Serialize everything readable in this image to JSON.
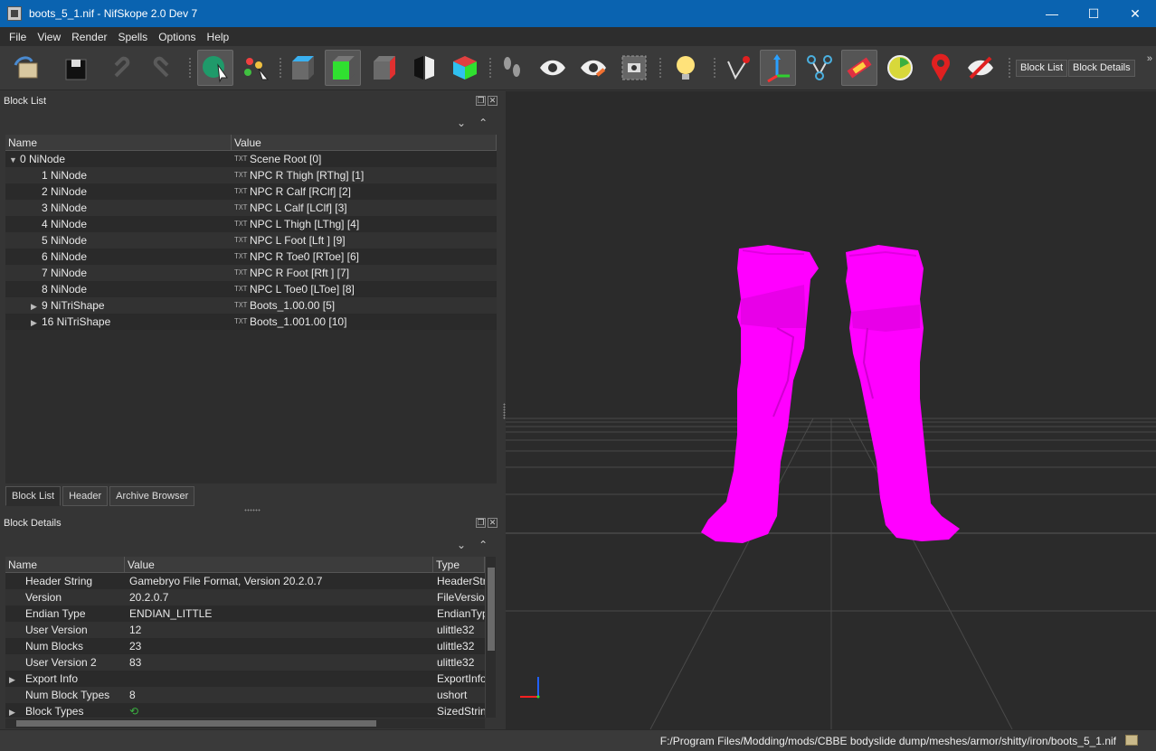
{
  "window": {
    "title": "boots_5_1.nif - NifSkope 2.0 Dev 7",
    "controls": [
      "—",
      "☐",
      "✕"
    ]
  },
  "menu": [
    "File",
    "View",
    "Render",
    "Spells",
    "Options",
    "Help"
  ],
  "toolbar": {
    "block_list_label": "Block List",
    "block_details_label": "Block Details",
    "extension_glyph": "»"
  },
  "block_list": {
    "title": "Block List",
    "columns": [
      "Name",
      "Value"
    ],
    "rows": [
      {
        "arrow": "▼",
        "name": "0 NiNode",
        "value": "Scene Root [0]",
        "level": 0
      },
      {
        "arrow": "",
        "name": "1 NiNode",
        "value": "NPC R Thigh [RThg] [1]",
        "level": 1
      },
      {
        "arrow": "",
        "name": "2 NiNode",
        "value": "NPC R Calf [RClf] [2]",
        "level": 1
      },
      {
        "arrow": "",
        "name": "3 NiNode",
        "value": "NPC L Calf [LClf] [3]",
        "level": 1
      },
      {
        "arrow": "",
        "name": "4 NiNode",
        "value": "NPC L Thigh [LThg] [4]",
        "level": 1
      },
      {
        "arrow": "",
        "name": "5 NiNode",
        "value": "NPC L Foot [Lft ] [9]",
        "level": 1
      },
      {
        "arrow": "",
        "name": "6 NiNode",
        "value": "NPC R Toe0 [RToe] [6]",
        "level": 1
      },
      {
        "arrow": "",
        "name": "7 NiNode",
        "value": "NPC R Foot [Rft ] [7]",
        "level": 1
      },
      {
        "arrow": "",
        "name": "8 NiNode",
        "value": "NPC L Toe0 [LToe] [8]",
        "level": 1
      },
      {
        "arrow": "▶",
        "name": "9 NiTriShape",
        "value": "Boots_1.00.00 [5]",
        "level": 1
      },
      {
        "arrow": "▶",
        "name": "16 NiTriShape",
        "value": "Boots_1.001.00 [10]",
        "level": 1
      }
    ],
    "txt_icon": "TXT",
    "tabs": [
      "Block List",
      "Header",
      "Archive Browser"
    ]
  },
  "block_details": {
    "title": "Block Details",
    "columns": [
      "Name",
      "Value",
      "Type"
    ],
    "rows": [
      {
        "arrow": "",
        "name": "Header String",
        "value": "Gamebryo File Format, Version 20.2.0.7",
        "type": "HeaderStr"
      },
      {
        "arrow": "",
        "name": "Version",
        "value": "20.2.0.7",
        "type": "FileVersion"
      },
      {
        "arrow": "",
        "name": "Endian Type",
        "value": "ENDIAN_LITTLE",
        "type": "EndianTyp"
      },
      {
        "arrow": "",
        "name": "User Version",
        "value": "12",
        "type": "ulittle32"
      },
      {
        "arrow": "",
        "name": "Num Blocks",
        "value": "23",
        "type": "ulittle32"
      },
      {
        "arrow": "",
        "name": "User Version 2",
        "value": "83",
        "type": "ulittle32"
      },
      {
        "arrow": "▶",
        "name": "Export Info",
        "value": "",
        "type": "ExportInfo"
      },
      {
        "arrow": "",
        "name": "Num Block Types",
        "value": "8",
        "type": "ushort"
      },
      {
        "arrow": "▶",
        "name": "Block Types",
        "value": "",
        "type": "SizedStrin"
      }
    ]
  },
  "status": {
    "path": "F:/Program Files/Modding/mods/CBBE bodyslide dump/meshes/armor/shitty/iron/boots_5_1.nif"
  },
  "colors": {
    "mesh": "#ff00ff",
    "titlebar": "#0a63b0",
    "viewport_bg": "#2b2b2b"
  }
}
